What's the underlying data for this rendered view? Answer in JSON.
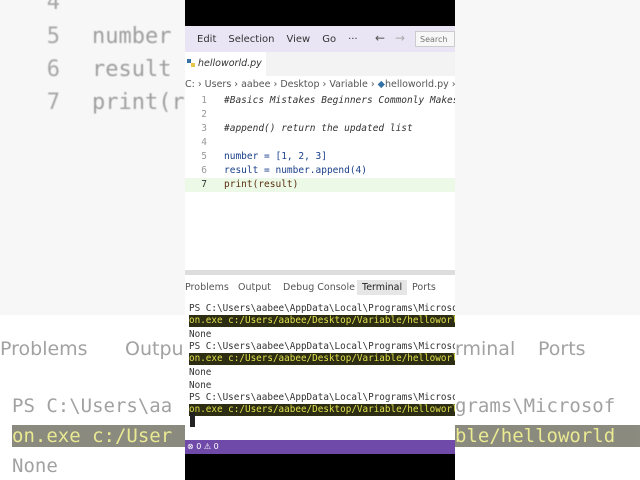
{
  "background": {
    "code_lines": [
      {
        "num": "4",
        "code": ""
      },
      {
        "num": "5",
        "code": "number"
      },
      {
        "num": "6",
        "code": "result"
      },
      {
        "num": "7",
        "code": "print(r"
      }
    ],
    "tabs": [
      "Problems",
      "Outpu",
      "rminal",
      "Ports"
    ],
    "terminal": [
      "PS C:\\Users\\aa",
      "on.exe c:/User",
      "None"
    ],
    "terminal_right": [
      "grams\\Microsof",
      "ble/helloworld"
    ]
  },
  "menu": {
    "items": [
      "Edit",
      "Selection",
      "View",
      "Go",
      "···"
    ],
    "back_icon": "←",
    "forward_icon": "→",
    "search_placeholder": "Search"
  },
  "tab": {
    "filename": "helloworld.py"
  },
  "breadcrumb": "C: › Users › aabee › Desktop › Variable › ",
  "breadcrumb_file": "helloworld.py",
  "breadcrumb_more": " › ...",
  "editor": {
    "lines": [
      {
        "num": "1",
        "text": "#Basics Mistakes Beginners Commonly Makes"
      },
      {
        "num": "2",
        "text": ""
      },
      {
        "num": "3",
        "text": "#append() return the updated list"
      },
      {
        "num": "4",
        "text": ""
      },
      {
        "num": "5",
        "text": "number = [1, 2, 3]"
      },
      {
        "num": "6",
        "text": "result = number.append(4)"
      },
      {
        "num": "7",
        "text": "print(result)"
      }
    ]
  },
  "panel": {
    "tabs": [
      "Problems",
      "Output",
      "Debug Console",
      "Terminal",
      "Ports"
    ],
    "active_tab": "Terminal"
  },
  "terminal": {
    "lines": [
      {
        "text": "PS C:\\Users\\aabee\\AppData\\Local\\Programs\\Microsoft",
        "hl": false
      },
      {
        "text": "on.exe c:/Users/aabee/Desktop/Variable/helloworld",
        "hl": true
      },
      {
        "text": "None",
        "hl": false
      },
      {
        "text": "PS C:\\Users\\aabee\\AppData\\Local\\Programs\\Microsoft",
        "hl": false
      },
      {
        "text": "on.exe c:/Users/aabee/Desktop/Variable/helloworld",
        "hl": true
      },
      {
        "text": "None",
        "hl": false
      },
      {
        "text": "None",
        "hl": false
      },
      {
        "text": "PS C:\\Users\\aabee\\AppData\\Local\\Programs\\Microsoft",
        "hl": false
      },
      {
        "text": "on.exe c:/Users/aabee/Desktop/Variable/helloworld",
        "hl": true
      }
    ]
  },
  "status": {
    "text": "⊗ 0  ⚠ 0"
  },
  "colors": {
    "status_bar": "#6f4aa8",
    "menu_bar": "#e9e5f4",
    "terminal_highlight": "#2d2d14"
  }
}
